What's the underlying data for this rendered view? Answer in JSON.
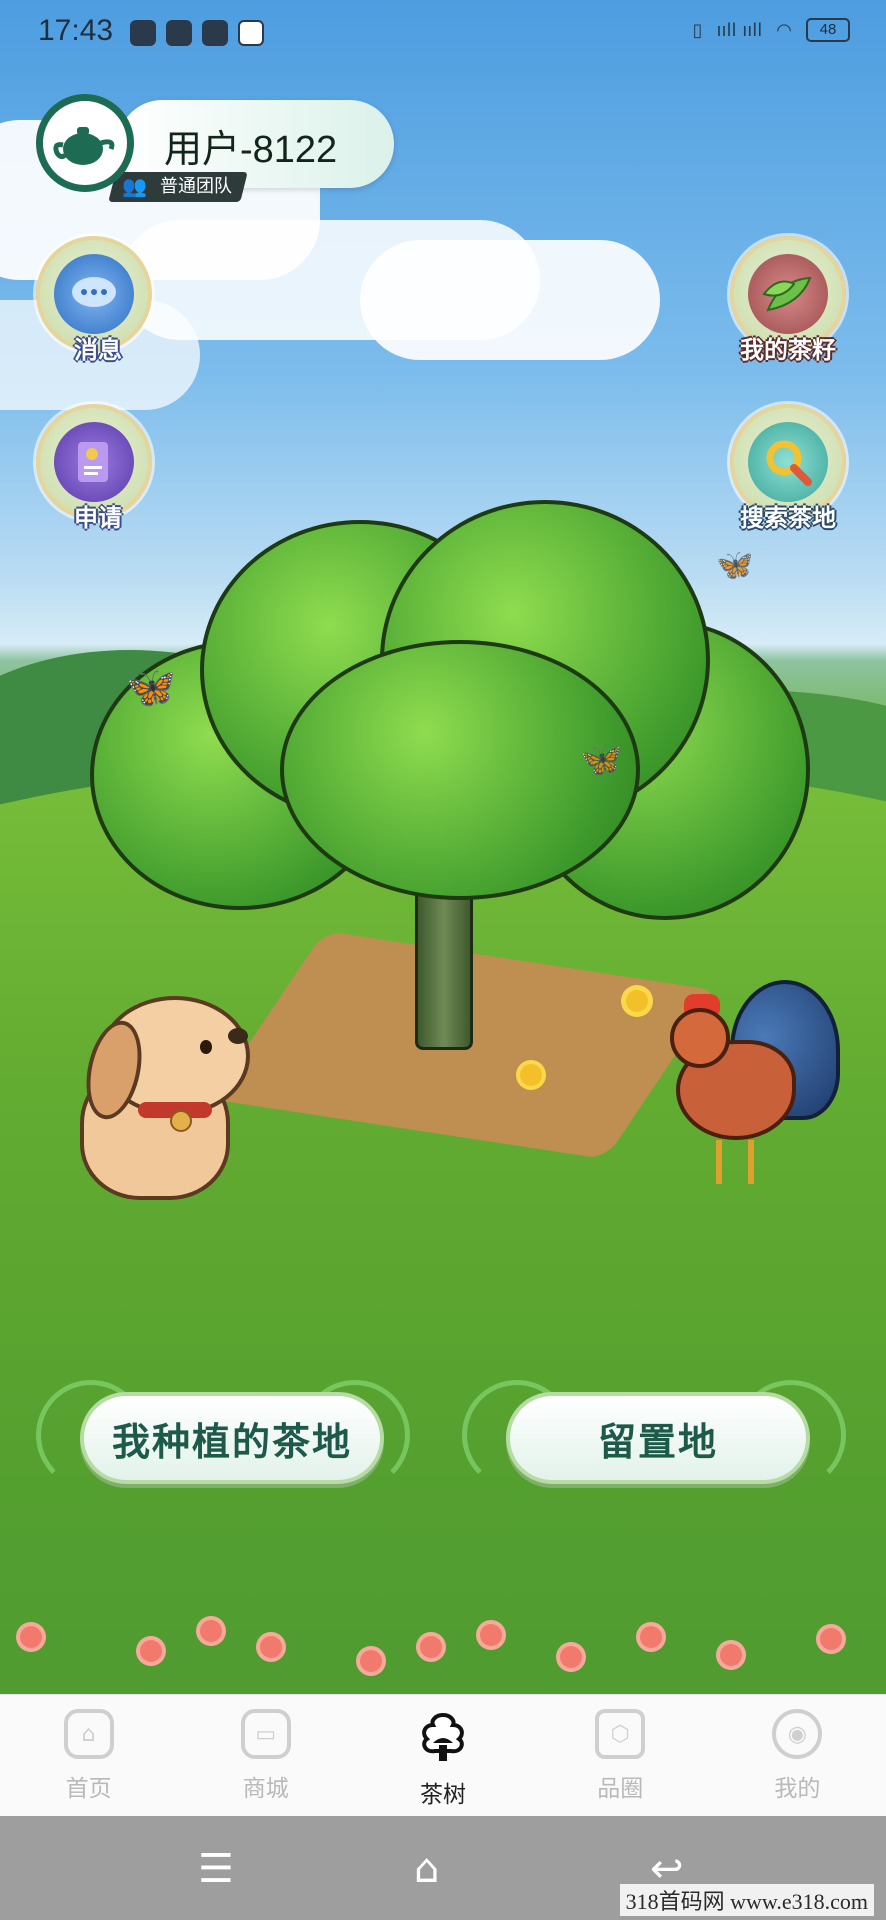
{
  "status_bar": {
    "time": "17:43",
    "battery": "48",
    "signal_text": "ııll ııll"
  },
  "user": {
    "name": "用户-8122",
    "team": "普通团队"
  },
  "side_buttons": {
    "messages": "消息",
    "apply": "申请",
    "my_seeds": "我的茶籽",
    "search_land": "搜索茶地"
  },
  "actions": {
    "my_planted_land": "我种植的茶地",
    "reserved_land": "留置地"
  },
  "tabs": [
    {
      "label": "首页",
      "icon": "home-icon"
    },
    {
      "label": "商城",
      "icon": "shop-icon"
    },
    {
      "label": "茶树",
      "icon": "tea-tree-icon"
    },
    {
      "label": "品圈",
      "icon": "circle-icon"
    },
    {
      "label": "我的",
      "icon": "profile-icon"
    }
  ],
  "active_tab": "茶树",
  "watermark": "318首码网  www.e318.com",
  "colors": {
    "accent": "#1d5a4a",
    "avatar_ring": "#1e6b53",
    "tab_active": "#222222",
    "tab_inactive": "#b9b9b9"
  }
}
